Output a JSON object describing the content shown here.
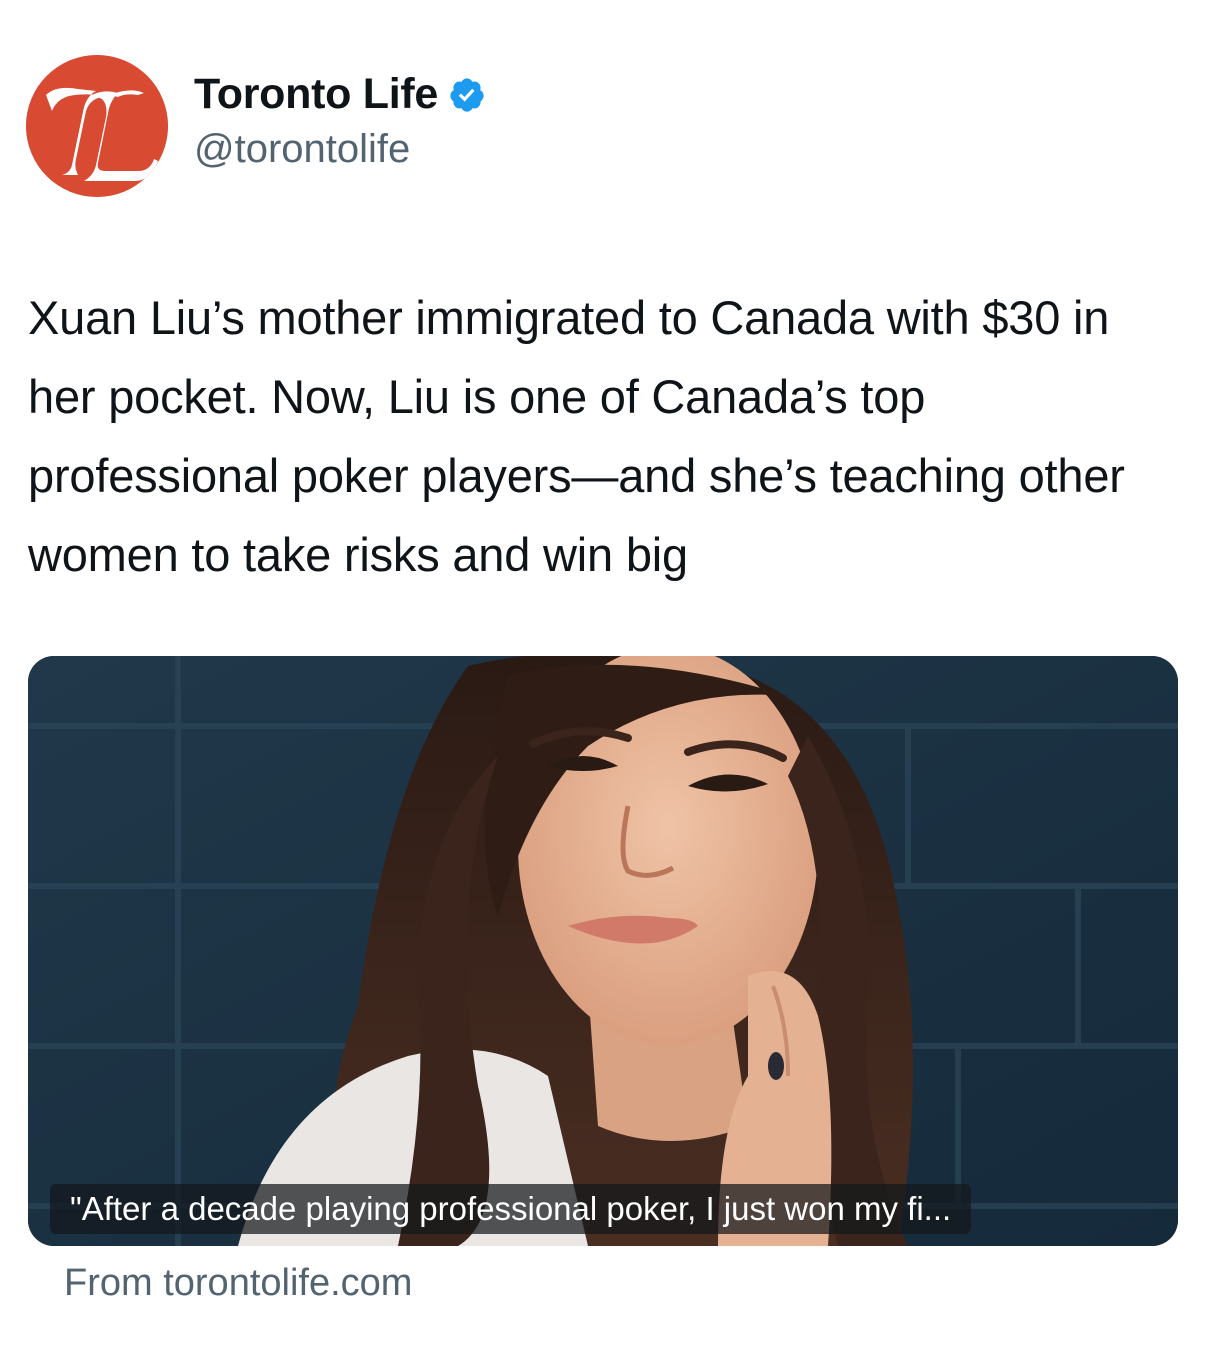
{
  "account": {
    "display_name": "Toronto Life",
    "handle": "@torontolife",
    "avatar_initials": "TL",
    "verified": true
  },
  "tweet": {
    "text": "Xuan Liu’s mother immigrated to Canada with $30 in her pocket. Now, Liu is one of Canada’s top professional poker players—and she’s teaching other women to take risks and win big"
  },
  "card": {
    "caption": "\"After a decade playing professional poker, I just won my fi...",
    "source": "From torontolife.com",
    "image": "portrait-photo"
  },
  "colors": {
    "avatar_bg": "#d94a33",
    "verified_blue": "#1d9bf0",
    "handle_gray": "#536471",
    "text_dark": "#0f1419"
  },
  "icons": {
    "verified": "verified-badge-icon",
    "avatar": "toronto-life-logo"
  }
}
